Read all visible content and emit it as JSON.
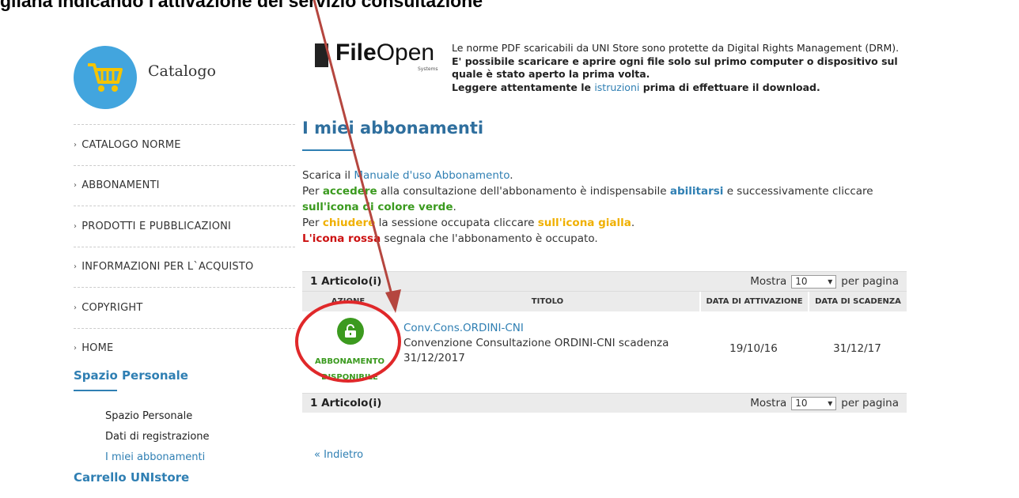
{
  "annotation": {
    "title": "gliana indicando l'attivazione del servizio consultazione"
  },
  "sidebar": {
    "logo_label": "Catalogo",
    "nav": [
      {
        "label": "CATALOGO NORME"
      },
      {
        "label": "ABBONAMENTI"
      },
      {
        "label": "PRODOTTI E PUBBLICAZIONI"
      },
      {
        "label": "INFORMAZIONI PER L`ACQUISTO"
      },
      {
        "label": "COPYRIGHT"
      },
      {
        "label": "HOME"
      }
    ],
    "personal_heading": "Spazio Personale",
    "personal_links": [
      "Spazio Personale",
      "Dati di registrazione",
      "I miei abbonamenti"
    ],
    "cart_heading": "Carrello UNIstore"
  },
  "fileopen": {
    "logo_bold": "File",
    "logo_rest": "Open",
    "logo_sub": "Systems",
    "line1": "Le norme PDF scaricabili da UNI Store sono protette da Digital Rights Management (DRM).",
    "line2": "E' possibile scaricare e aprire ogni file solo sul primo computer o dispositivo sul quale è stato aperto la prima volta.",
    "line3_pre": "Leggere attentamente le ",
    "line3_link": "istruzioni",
    "line3_post": " prima di effettuare il download."
  },
  "main": {
    "title": "I miei abbonamenti",
    "intro": {
      "l1_pre": "Scarica il ",
      "l1_link": "Manuale d'uso Abbonamento",
      "l1_post": ".",
      "l2_a": "Per ",
      "l2_b": "accedere",
      "l2_c": " alla consultazione dell'abbonamento è indispensabile ",
      "l2_d": "abilitarsi",
      "l2_e": " e successivamente cliccare ",
      "l2_f": "sull'icona di colore verde",
      "l2_g": ".",
      "l3_a": "Per ",
      "l3_b": "chiudere",
      "l3_c": " la sessione occupata cliccare ",
      "l3_d": "sull'icona gialla",
      "l3_e": ".",
      "l4_a": "L'icona rossa",
      "l4_b": " segnala che l'abbonamento è occupato."
    },
    "table": {
      "count_label": "1 Articolo(i)",
      "show_label": "Mostra",
      "per_page_value": "10",
      "per_page_label": "per pagina",
      "headers": [
        "AZIONE",
        "TITOLO",
        "DATA DI ATTIVAZIONE",
        "DATA DI SCADENZA"
      ],
      "rows": [
        {
          "status": "ABBONAMENTO DISPONIBILE",
          "code": "Conv.Cons.ORDINI-CNI",
          "description": "Convenzione Consultazione ORDINI-CNI scadenza 31/12/2017",
          "activation": "19/10/16",
          "expiry": "31/12/17"
        }
      ]
    },
    "back_link": "« Indietro"
  },
  "colors": {
    "accent_blue": "#2f7fb3",
    "available_green": "#3a9a1e",
    "annotation_red": "#e0282a",
    "arrow": "#b5463f"
  }
}
